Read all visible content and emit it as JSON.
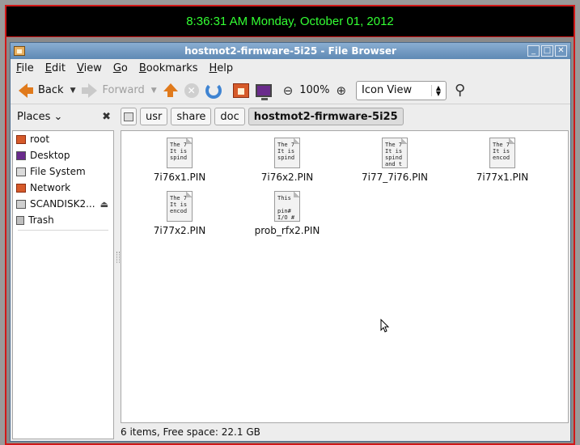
{
  "clock": {
    "text": "8:36:31 AM Monday, October 01, 2012"
  },
  "window": {
    "title": "hostmot2-firmware-5i25 - File Browser",
    "controls": {
      "minimize": "_",
      "maximize": "□",
      "close": "✕"
    }
  },
  "menu": {
    "items": [
      {
        "u": "F",
        "rest": "ile"
      },
      {
        "u": "E",
        "rest": "dit"
      },
      {
        "u": "V",
        "rest": "iew"
      },
      {
        "u": "G",
        "rest": "o"
      },
      {
        "u": "B",
        "rest": "ookmarks"
      },
      {
        "u": "H",
        "rest": "elp"
      }
    ]
  },
  "toolbar": {
    "back_label": "Back",
    "forward_label": "Forward",
    "zoom_level": "100%",
    "view_mode": "Icon View"
  },
  "places": {
    "header": "Places",
    "close": "✖"
  },
  "pathbar": {
    "crumbs": [
      "usr",
      "share",
      "doc",
      "hostmot2-firmware-5i25"
    ]
  },
  "sidebar": {
    "items": [
      {
        "label": "root",
        "icon": "home-folder-icon"
      },
      {
        "label": "Desktop",
        "icon": "desktop-icon"
      },
      {
        "label": "File System",
        "icon": "filesystem-icon"
      },
      {
        "label": "Network",
        "icon": "network-icon"
      },
      {
        "label": "SCANDISK2...",
        "icon": "drive-icon"
      }
    ],
    "trash": "Trash"
  },
  "files": [
    {
      "name": "7i76x1.PIN",
      "preview": "The 7\nIt is\nspind"
    },
    {
      "name": "7i76x2.PIN",
      "preview": "The 7\nIt is\nspind"
    },
    {
      "name": "7i77_7i76.PIN",
      "preview": "The 7\nIt is\nspind\nand t"
    },
    {
      "name": "7i77x1.PIN",
      "preview": "The 7\nIt is\nencod"
    },
    {
      "name": "7i77x2.PIN",
      "preview": "The 7\nIt is\nencod"
    },
    {
      "name": "prob_rfx2.PIN",
      "preview": "This\n\npin#\nI/O #"
    }
  ],
  "status": {
    "text": "6 items, Free space: 22.1 GB"
  },
  "colors": {
    "clock_text": "#33ff33",
    "frame": "#d01818",
    "accent": "#e07a1c"
  }
}
